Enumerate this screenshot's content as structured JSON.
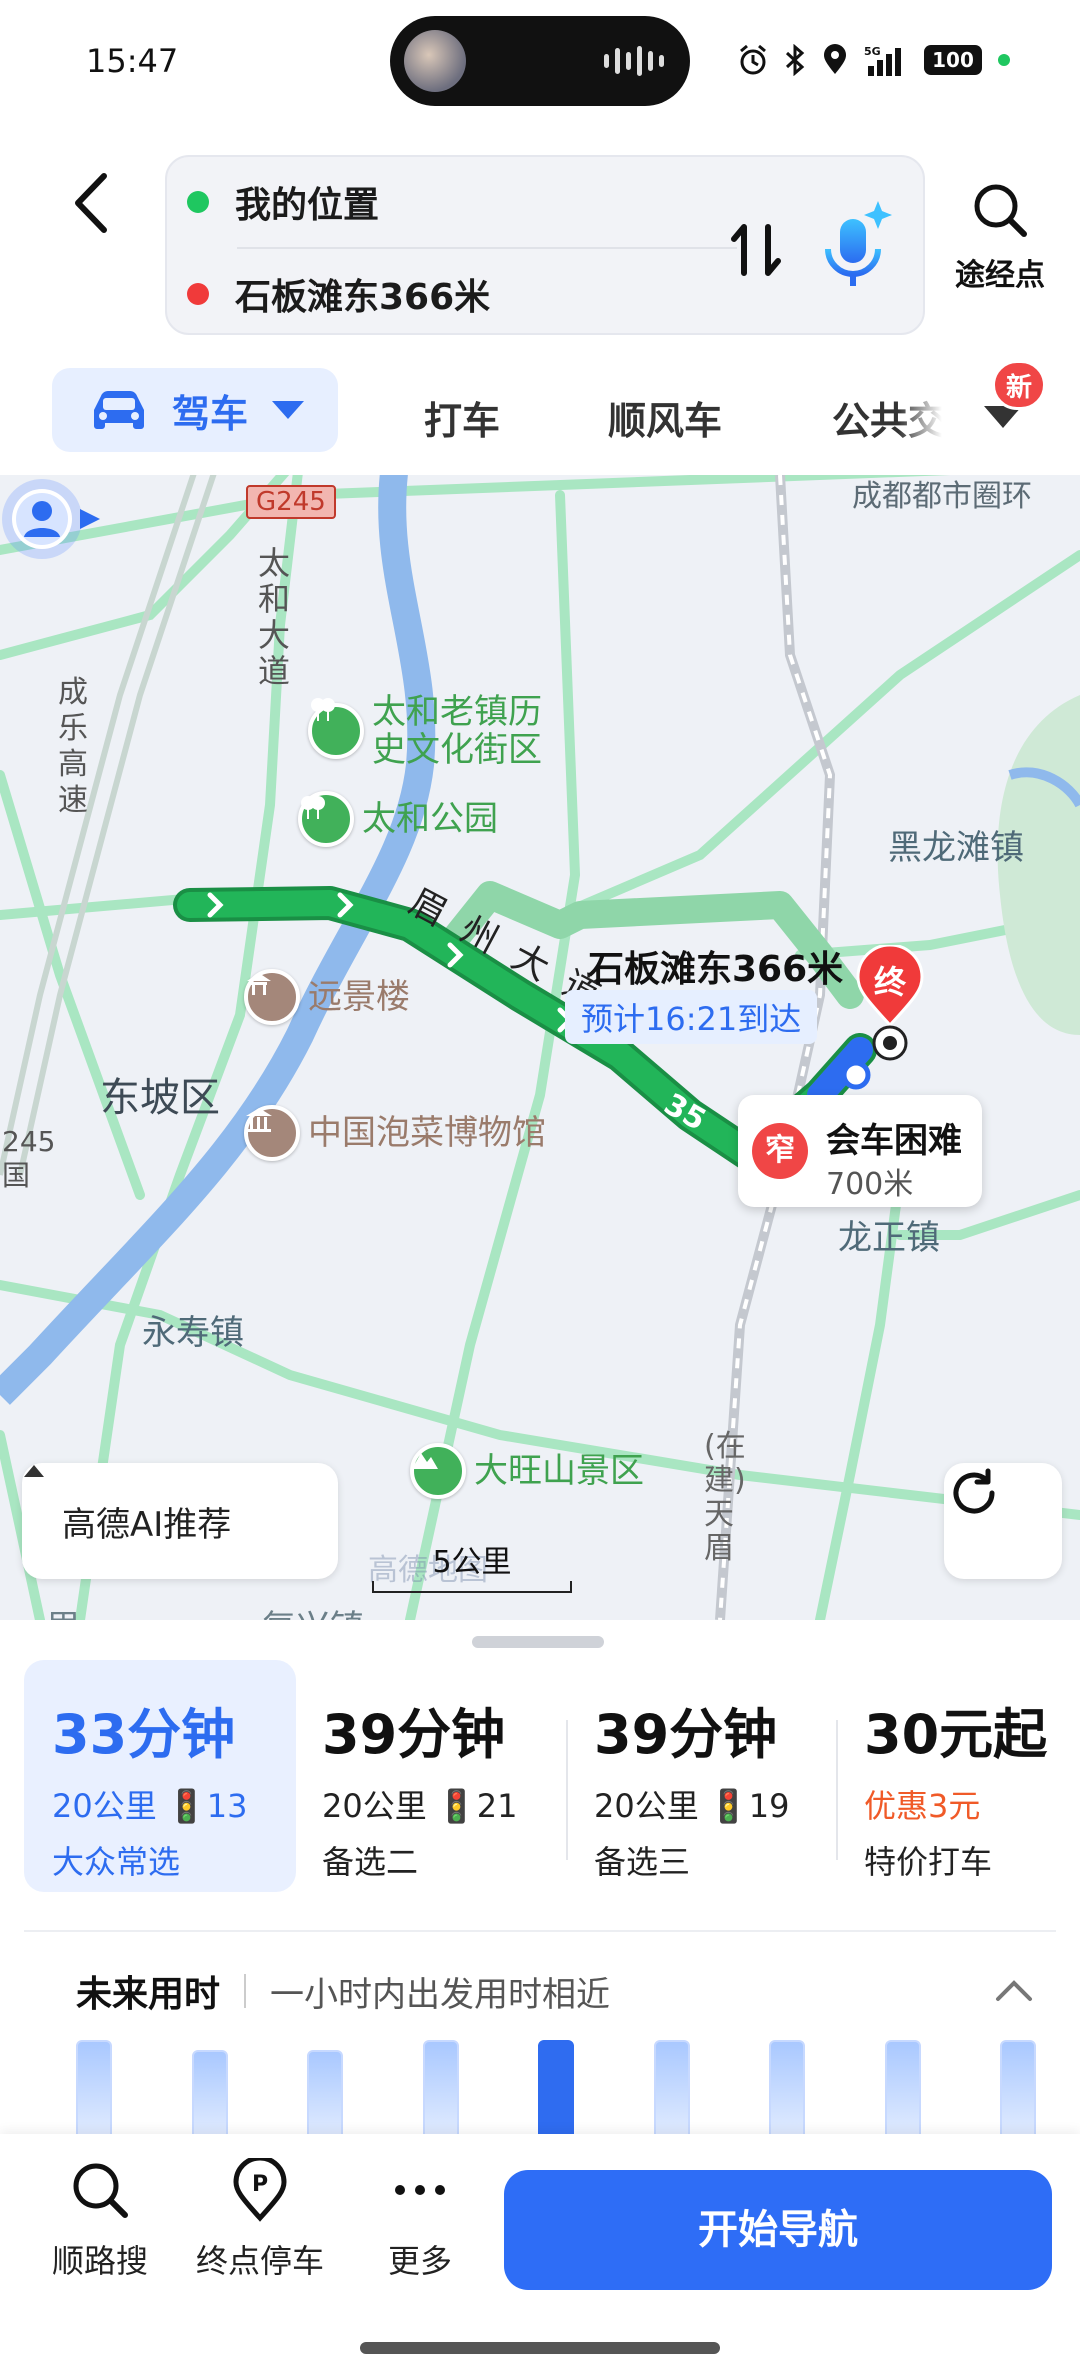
{
  "status_bar": {
    "time": "15:47",
    "battery": "100",
    "network": "5G"
  },
  "route": {
    "origin": "我的位置",
    "destination": "石板滩东366米",
    "origin_color": "#1fc760",
    "destination_color": "#f03a3a",
    "waypoint_label": "途经点"
  },
  "tabs": {
    "items": [
      "驾车",
      "打车",
      "顺风车",
      "公共交"
    ],
    "active_index": 0,
    "new_badge": "新"
  },
  "map": {
    "road_g245": "G245",
    "road_taihe": "太和大道",
    "road_chengle": "成乐高速",
    "road_meizhou": "眉州大道",
    "road_chengdu_ring": "成都都市圈环",
    "road_245": "245国",
    "road_under_construction": "(在建)天眉",
    "speed_marker": "35",
    "towns": {
      "dongpo": "东坡区",
      "heilongtan": "黑龙滩镇",
      "longzheng": "龙正镇",
      "yongshou": "永寿镇",
      "fuxing": "复兴镇",
      "bottom_left": "眉"
    },
    "pois": [
      {
        "name": "太和老镇历\n史文化街区",
        "type": "park"
      },
      {
        "name": "太和公园",
        "type": "park"
      },
      {
        "name": "远景楼",
        "type": "landmark"
      },
      {
        "name": "中国泡菜博物馆",
        "type": "museum"
      },
      {
        "name": "大旺山景区",
        "type": "scenic"
      }
    ],
    "destination_label": "石板滩东366米",
    "eta": "预计16:21到达",
    "end_marker": "终",
    "warning": {
      "badge": "窄",
      "title": "会车困难",
      "distance": "700米"
    },
    "ai_button": "高德AI推荐",
    "scale": "5公里",
    "watermark": "高德地图",
    "colors": {
      "route": "#22b559",
      "route_alt": "#8fd6a9",
      "road": "#a9e6c2",
      "water": "#8fb9ec"
    }
  },
  "plans": [
    {
      "duration": "33分钟",
      "meta": "20公里 🚦13",
      "tag": "大众常选"
    },
    {
      "duration": "39分钟",
      "meta": "20公里 🚦21",
      "tag": "备选二"
    },
    {
      "duration": "39分钟",
      "meta": "20公里 🚦19",
      "tag": "备选三"
    },
    {
      "duration": "30元起",
      "meta": "优惠3元",
      "tag": "特价打车"
    }
  ],
  "future": {
    "title": "未来用时",
    "subtitle": "一小时内出发用时相近",
    "bars": [
      0.55,
      0.5,
      0.5,
      0.55,
      0.55,
      0.55,
      0.55,
      0.55,
      0.55
    ],
    "current_index": 4
  },
  "bottom_bar": {
    "search_label": "顺路搜",
    "parking_label": "终点停车",
    "more_label": "更多",
    "navigate_label": "开始导航"
  }
}
